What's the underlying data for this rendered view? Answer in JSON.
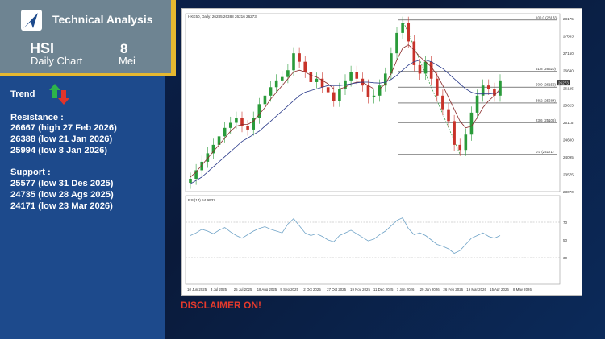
{
  "header": {
    "title": "Technical Analysis",
    "ticker": "HSI",
    "chart_label": "Daily Chart",
    "day": "8",
    "month": "Mei"
  },
  "trend": {
    "label": "Trend",
    "arrow_up_color": "#2db34a",
    "arrow_down_color": "#e0342b"
  },
  "resistance": {
    "title": "Resistance :",
    "levels": [
      "26667 (high 27 Feb 2026)",
      "26388 (low 21 Jan 2026)",
      "25994 (low 8 Jan 2026)"
    ]
  },
  "support": {
    "title": "Support :",
    "levels": [
      "25577 (low 31 Des 2025)",
      "24735 (low 28 Ags 2025)",
      "24171 (low 23 Mar 2026)"
    ]
  },
  "disclaimer": "DISCLAIMER ON!",
  "chart_data": {
    "type": "line",
    "symbol_header": "HKK50, Daily: 26285 26388 26216 26273",
    "last_price": "26273",
    "rsi_label": "RSI(14) 54.9932",
    "x_ticks": [
      "10 Jun 2025",
      "3 Jul 2025",
      "25 Jul 2025",
      "18 Aug 2025",
      "9 Sep 2025",
      "2 Oct 2025",
      "27 Oct 2025",
      "19 Nov 2025",
      "11 Dec 2025",
      "7 Jan 2026",
      "29 Jan 2026",
      "26 Feb 2026",
      "19 Mar 2026",
      "15 Apr 2026",
      "8 May 2026"
    ],
    "y_ticks": [
      28175,
      27663,
      27150,
      26640,
      26125,
      25625,
      25115,
      24600,
      24095,
      23575,
      23070
    ],
    "ylim": [
      23070,
      28175
    ],
    "rsi_ticks": [
      70,
      50,
      30
    ],
    "rsi_ylim": [
      0,
      100
    ],
    "fib_levels": [
      {
        "label": "100.0 (28133)",
        "value": 28133
      },
      {
        "label": "61.8 (26620)",
        "value": 26620
      },
      {
        "label": "50.0 (26152)",
        "value": 26152
      },
      {
        "label": "38.2 (25684)",
        "value": 25684
      },
      {
        "label": "23.6 (25106)",
        "value": 25106
      },
      {
        "label": "0.0 (24171)",
        "value": 24171
      }
    ],
    "price": [
      23450,
      23700,
      23950,
      24200,
      24450,
      24700,
      24950,
      25100,
      25250,
      25000,
      24900,
      25250,
      25650,
      25900,
      26150,
      26350,
      26450,
      26650,
      27150,
      26900,
      26600,
      26300,
      26400,
      26150,
      26000,
      25750,
      26100,
      26350,
      26600,
      26400,
      26200,
      25850,
      25900,
      26200,
      26550,
      27150,
      27750,
      28050,
      27500,
      26800,
      26550,
      26900,
      26400,
      25900,
      25500,
      25150,
      24450,
      24300,
      24750,
      25400,
      25900,
      26200,
      26100,
      25900,
      26350
    ],
    "ma_fast": [
      23500,
      23650,
      23850,
      24050,
      24250,
      24450,
      24650,
      24850,
      25000,
      25050,
      25050,
      25150,
      25350,
      25550,
      25800,
      26000,
      26200,
      26400,
      26600,
      26650,
      26600,
      26500,
      26450,
      26350,
      26250,
      26100,
      26100,
      26150,
      26250,
      26300,
      26300,
      26200,
      26100,
      26100,
      26250,
      26550,
      26950,
      27300,
      27400,
      27250,
      27050,
      26900,
      26750,
      26500,
      26200,
      25850,
      25500,
      25150,
      24950,
      25000,
      25250,
      25550,
      25750,
      25900,
      26100
    ],
    "ma_slow": [
      23300,
      23400,
      23500,
      23650,
      23800,
      23950,
      24100,
      24250,
      24400,
      24550,
      24650,
      24750,
      24850,
      25000,
      25150,
      25300,
      25450,
      25600,
      25750,
      25900,
      26000,
      26050,
      26100,
      26150,
      26200,
      26200,
      26200,
      26220,
      26250,
      26280,
      26300,
      26300,
      26280,
      26270,
      26300,
      26380,
      26500,
      26650,
      26800,
      26900,
      26950,
      26950,
      26900,
      26800,
      26700,
      26550,
      26400,
      26250,
      26100,
      26000,
      25950,
      25950,
      25950,
      25970,
      26000
    ],
    "rsi": [
      55,
      58,
      62,
      60,
      57,
      61,
      64,
      59,
      55,
      52,
      56,
      60,
      63,
      65,
      62,
      60,
      58,
      68,
      74,
      66,
      58,
      55,
      57,
      54,
      50,
      48,
      55,
      58,
      61,
      57,
      53,
      49,
      51,
      56,
      60,
      66,
      72,
      75,
      63,
      56,
      58,
      55,
      50,
      45,
      43,
      40,
      35,
      38,
      45,
      52,
      55,
      58,
      54,
      52,
      55
    ]
  }
}
